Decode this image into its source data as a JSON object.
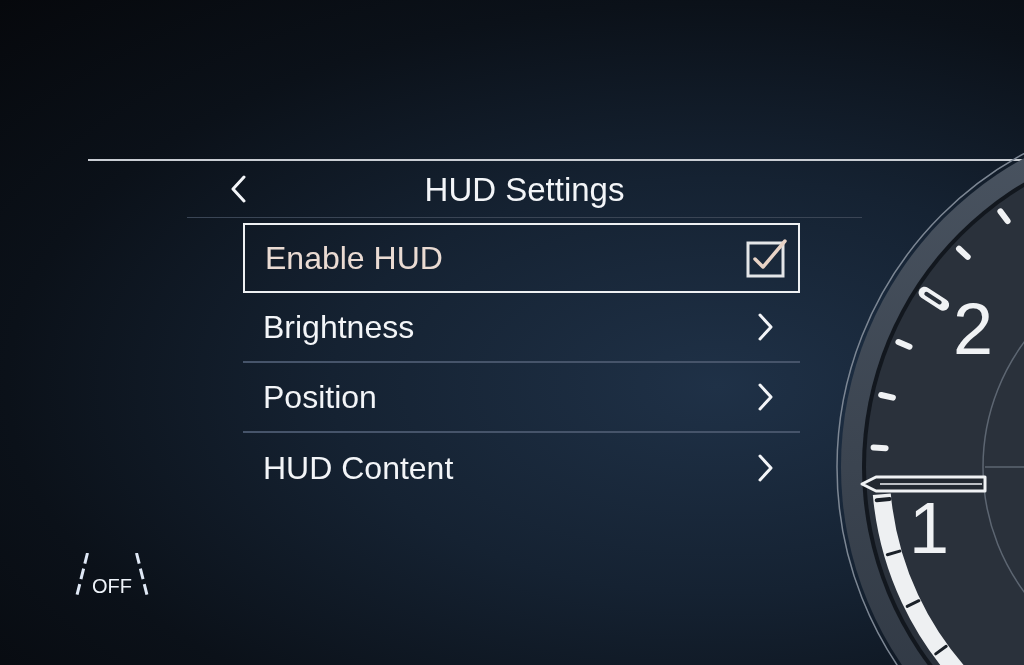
{
  "header": {
    "title": "HUD Settings"
  },
  "menu": {
    "items": [
      {
        "kind": "checkbox",
        "label": "Enable HUD",
        "selected": true,
        "checked": true
      },
      {
        "kind": "submenu",
        "label": "Brightness",
        "selected": false
      },
      {
        "kind": "submenu",
        "label": "Position",
        "selected": false
      },
      {
        "kind": "submenu",
        "label": "HUD Content",
        "selected": false
      }
    ]
  },
  "gauge": {
    "numbers": [
      "2",
      "1"
    ]
  },
  "lane_assist": {
    "label": "OFF"
  }
}
